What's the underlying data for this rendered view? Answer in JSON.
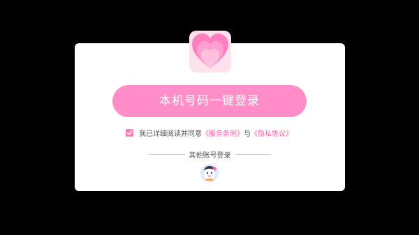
{
  "login": {
    "one_click_label": "本机号码一键登录"
  },
  "agreement": {
    "prefix": "我已详细阅读并同意",
    "terms_label": "《服务条例》",
    "connector": "与",
    "privacy_label": "《隐私协议》",
    "checked": true
  },
  "other_login": {
    "label": "其他账号登录"
  },
  "icons": {
    "logo": "heart-logo-icon",
    "checkbox": "check-icon",
    "alt_login": "account-avatar-icon"
  },
  "colors": {
    "background": "#000000",
    "card": "#ffffff",
    "accent_pink": "#ff8ec8",
    "link_pink": "#ff5fa5"
  }
}
